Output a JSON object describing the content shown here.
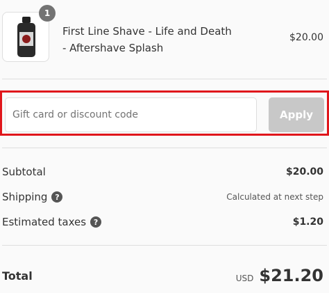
{
  "line_item": {
    "quantity": "1",
    "name": "First Line Shave - Life and Death - Aftershave Splash",
    "price": "$20.00",
    "image_icon": "aftershave-bottle-icon"
  },
  "discount": {
    "placeholder": "Gift card or discount code",
    "value": "",
    "apply_label": "Apply",
    "highlight_color": "#e0161b"
  },
  "summary": {
    "subtotal_label": "Subtotal",
    "subtotal_value": "$20.00",
    "shipping_label": "Shipping",
    "shipping_value": "Calculated at next step",
    "shipping_help_icon": "question-icon",
    "taxes_label": "Estimated taxes",
    "taxes_value": "$1.20",
    "taxes_help_icon": "question-icon"
  },
  "total": {
    "label": "Total",
    "currency": "USD",
    "value": "$21.20"
  }
}
